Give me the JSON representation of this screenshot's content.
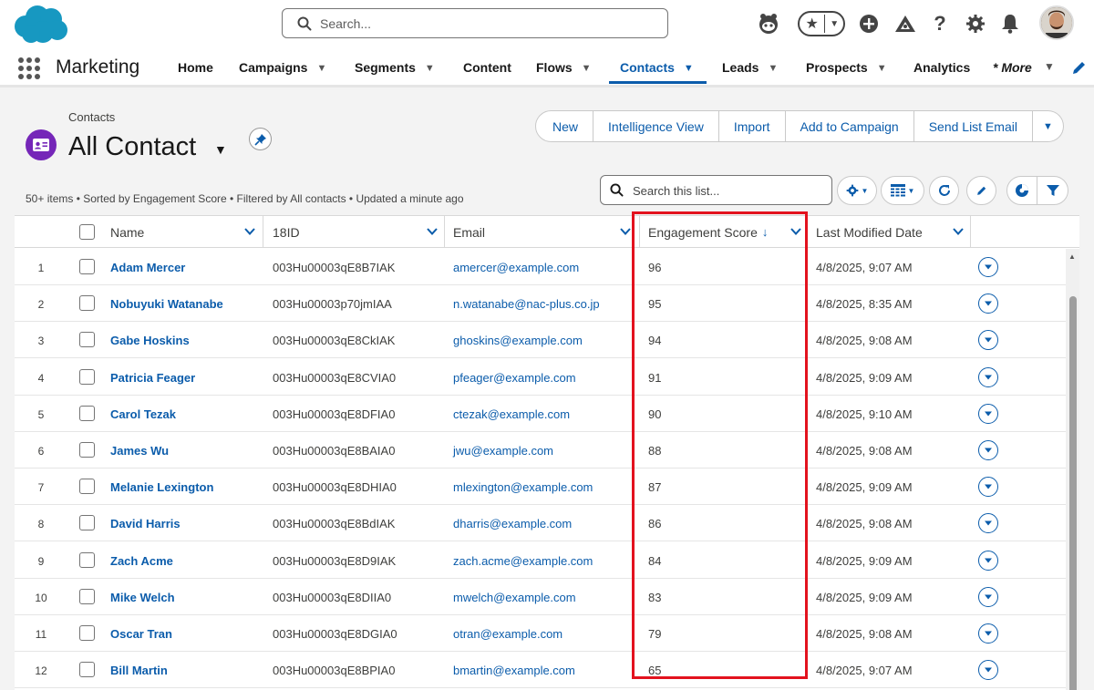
{
  "global_header": {
    "search_placeholder": "Search...",
    "icons": [
      "astro-icon",
      "favorites-star-icon",
      "add-icon",
      "trailhead-icon",
      "help-icon",
      "settings-gear-icon",
      "notifications-bell-icon",
      "user-avatar"
    ]
  },
  "nav": {
    "app_name": "Marketing",
    "items": [
      {
        "label": "Home",
        "has_menu": false
      },
      {
        "label": "Campaigns",
        "has_menu": true
      },
      {
        "label": "Segments",
        "has_menu": true
      },
      {
        "label": "Content",
        "has_menu": false
      },
      {
        "label": "Flows",
        "has_menu": true
      },
      {
        "label": "Contacts",
        "has_menu": true,
        "active": true
      },
      {
        "label": "Leads",
        "has_menu": true
      },
      {
        "label": "Prospects",
        "has_menu": true
      },
      {
        "label": "Analytics",
        "has_menu": false
      }
    ],
    "more_label": "* More"
  },
  "page": {
    "object_label": "Contacts",
    "list_view_name": "All Contact",
    "buttons": [
      "New",
      "Intelligence View",
      "Import",
      "Add to Campaign",
      "Send List Email"
    ],
    "meta": "50+ items • Sorted by Engagement Score • Filtered by All contacts • Updated a minute ago",
    "list_search_placeholder": "Search this list..."
  },
  "table": {
    "columns": [
      "Name",
      "18ID",
      "Email",
      "Engagement Score",
      "Last Modified Date"
    ],
    "sort_indicator": "↓",
    "rows": [
      {
        "num": "1",
        "name": "Adam Mercer",
        "id": "003Hu00003qE8B7IAK",
        "email": "amercer@example.com",
        "score": "96",
        "modified": "4/8/2025, 9:07 AM"
      },
      {
        "num": "2",
        "name": "Nobuyuki Watanabe",
        "id": "003Hu00003p70jmIAA",
        "email": "n.watanabe@nac-plus.co.jp",
        "score": "95",
        "modified": "4/8/2025, 8:35 AM"
      },
      {
        "num": "3",
        "name": "Gabe Hoskins",
        "id": "003Hu00003qE8CkIAK",
        "email": "ghoskins@example.com",
        "score": "94",
        "modified": "4/8/2025, 9:08 AM"
      },
      {
        "num": "4",
        "name": "Patricia Feager",
        "id": "003Hu00003qE8CVIA0",
        "email": "pfeager@example.com",
        "score": "91",
        "modified": "4/8/2025, 9:09 AM"
      },
      {
        "num": "5",
        "name": "Carol Tezak",
        "id": "003Hu00003qE8DFIA0",
        "email": "ctezak@example.com",
        "score": "90",
        "modified": "4/8/2025, 9:10 AM"
      },
      {
        "num": "6",
        "name": "James Wu",
        "id": "003Hu00003qE8BAIA0",
        "email": "jwu@example.com",
        "score": "88",
        "modified": "4/8/2025, 9:08 AM"
      },
      {
        "num": "7",
        "name": "Melanie Lexington",
        "id": "003Hu00003qE8DHIA0",
        "email": "mlexington@example.com",
        "score": "87",
        "modified": "4/8/2025, 9:09 AM"
      },
      {
        "num": "8",
        "name": "David Harris",
        "id": "003Hu00003qE8BdIAK",
        "email": "dharris@example.com",
        "score": "86",
        "modified": "4/8/2025, 9:08 AM"
      },
      {
        "num": "9",
        "name": "Zach Acme",
        "id": "003Hu00003qE8D9IAK",
        "email": "zach.acme@example.com",
        "score": "84",
        "modified": "4/8/2025, 9:09 AM"
      },
      {
        "num": "10",
        "name": "Mike Welch",
        "id": "003Hu00003qE8DIIA0",
        "email": "mwelch@example.com",
        "score": "83",
        "modified": "4/8/2025, 9:09 AM"
      },
      {
        "num": "11",
        "name": "Oscar Tran",
        "id": "003Hu00003qE8DGIA0",
        "email": "otran@example.com",
        "score": "79",
        "modified": "4/8/2025, 9:08 AM"
      },
      {
        "num": "12",
        "name": "Bill Martin",
        "id": "003Hu00003qE8BPIA0",
        "email": "bmartin@example.com",
        "score": "65",
        "modified": "4/8/2025, 9:07 AM"
      }
    ]
  },
  "colors": {
    "brand_blue": "#0b5cab",
    "salesforce_cloud": "#1798c1",
    "contact_icon": "#7526b8",
    "highlight": "#e3121e"
  }
}
